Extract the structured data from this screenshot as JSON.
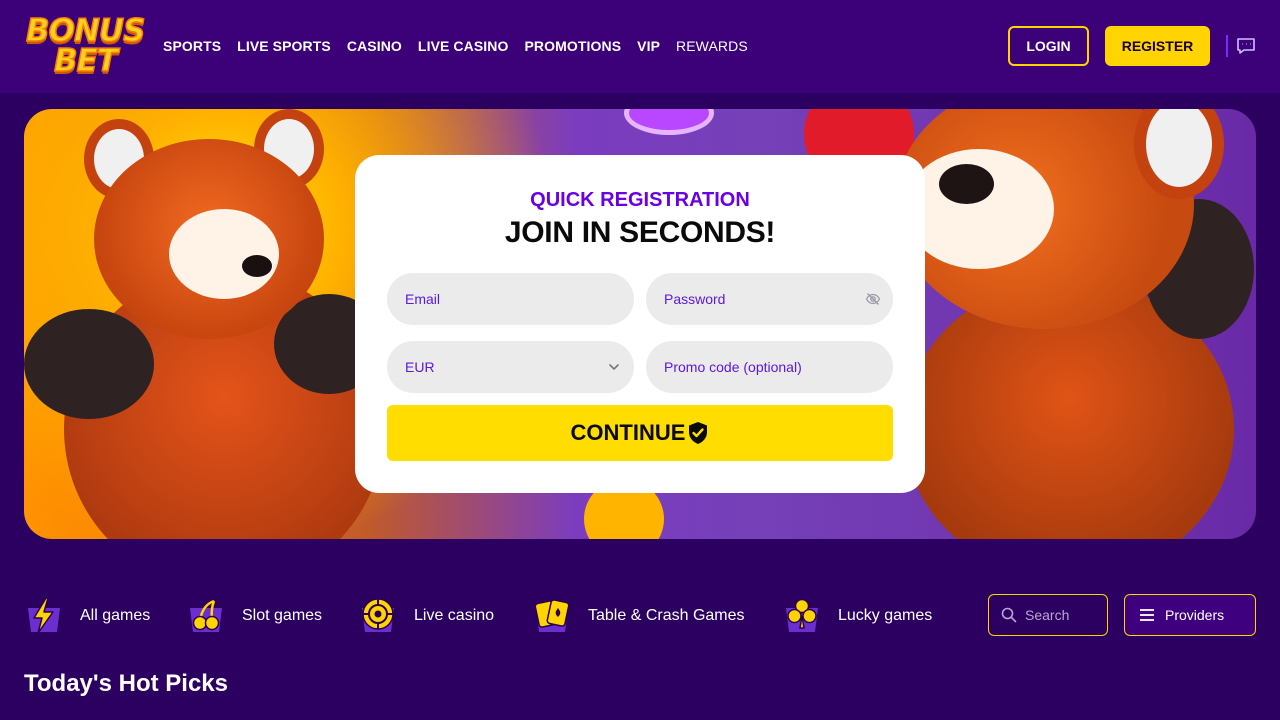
{
  "brand": {
    "logo_line1": "BONUS",
    "logo_line2": "BET"
  },
  "nav": [
    "SPORTS",
    "LIVE SPORTS",
    "CASINO",
    "LIVE CASINO",
    "PROMOTIONS",
    "VIP",
    "REWARDS"
  ],
  "header": {
    "login_label": "LOGIN",
    "register_label": "REGISTER",
    "chat_icon": "chat-bubble-icon"
  },
  "form": {
    "kicker": "QUICK REGISTRATION",
    "title": "JOIN IN SECONDS!",
    "email_placeholder": "Email",
    "password_placeholder": "Password",
    "currency_value": "EUR",
    "promo_placeholder": "Promo code (optional)",
    "continue_label": "CONTINUE"
  },
  "categories": [
    {
      "label": "All games",
      "icon": "lightning-icon"
    },
    {
      "label": "Slot games",
      "icon": "cherry-icon"
    },
    {
      "label": "Live casino",
      "icon": "roulette-icon"
    },
    {
      "label": "Table & Crash Games",
      "icon": "cards-icon"
    },
    {
      "label": "Lucky games",
      "icon": "clover-icon"
    }
  ],
  "search": {
    "placeholder": "Search"
  },
  "providers_label": "Providers",
  "section_title": "Today's Hot Picks",
  "colors": {
    "header_bg": "#3c0078",
    "page_bg": "#2c0060",
    "accent": "#ffd400",
    "purple": "#6a00e6"
  }
}
